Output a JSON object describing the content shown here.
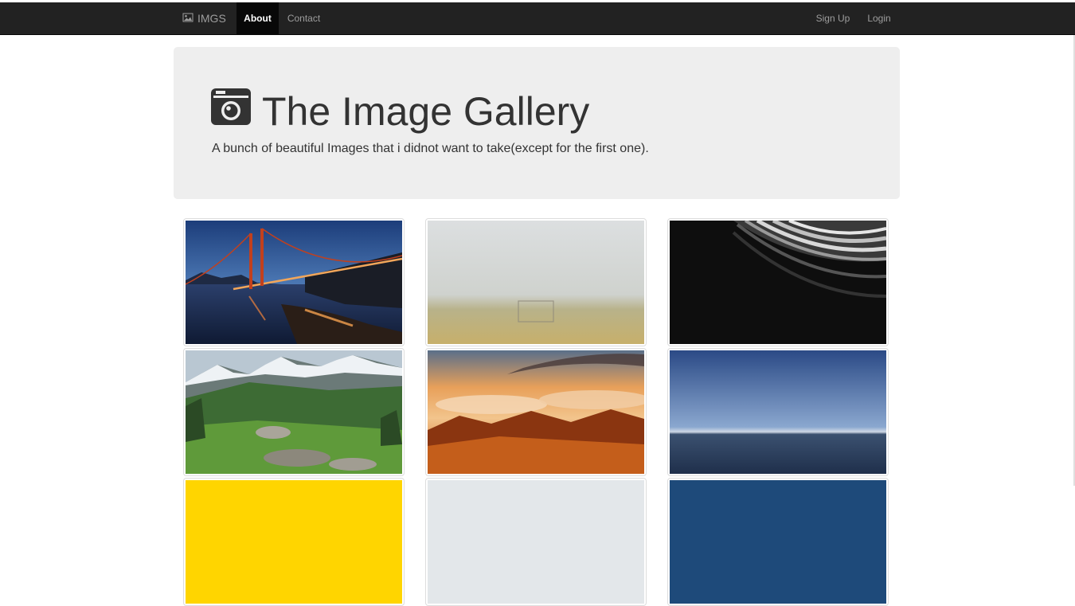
{
  "navbar": {
    "brand_icon": "picture-icon",
    "brand": "IMGS",
    "links": [
      "About",
      "Contact"
    ],
    "active": "About",
    "right_links": [
      "Sign Up",
      "Login"
    ]
  },
  "jumbotron": {
    "icon": "camera-icon",
    "title": "The Image Gallery",
    "subtitle": "A bunch of beautiful Images that i didnot want to take(except for the first one)."
  },
  "gallery": [
    "golden-gate-bridge-at-dusk",
    "foggy-field-with-goal",
    "black-white-architecture",
    "green-mountains-with-snow",
    "orange-sunset-over-mountains",
    "blue-sea-horizon",
    "yellow-image",
    "light-image",
    "blue-image"
  ],
  "colors": {
    "navbar_bg": "#222222",
    "navbar_active_bg": "#080808",
    "jumbotron_bg": "#eeeeee",
    "text": "#333333"
  }
}
